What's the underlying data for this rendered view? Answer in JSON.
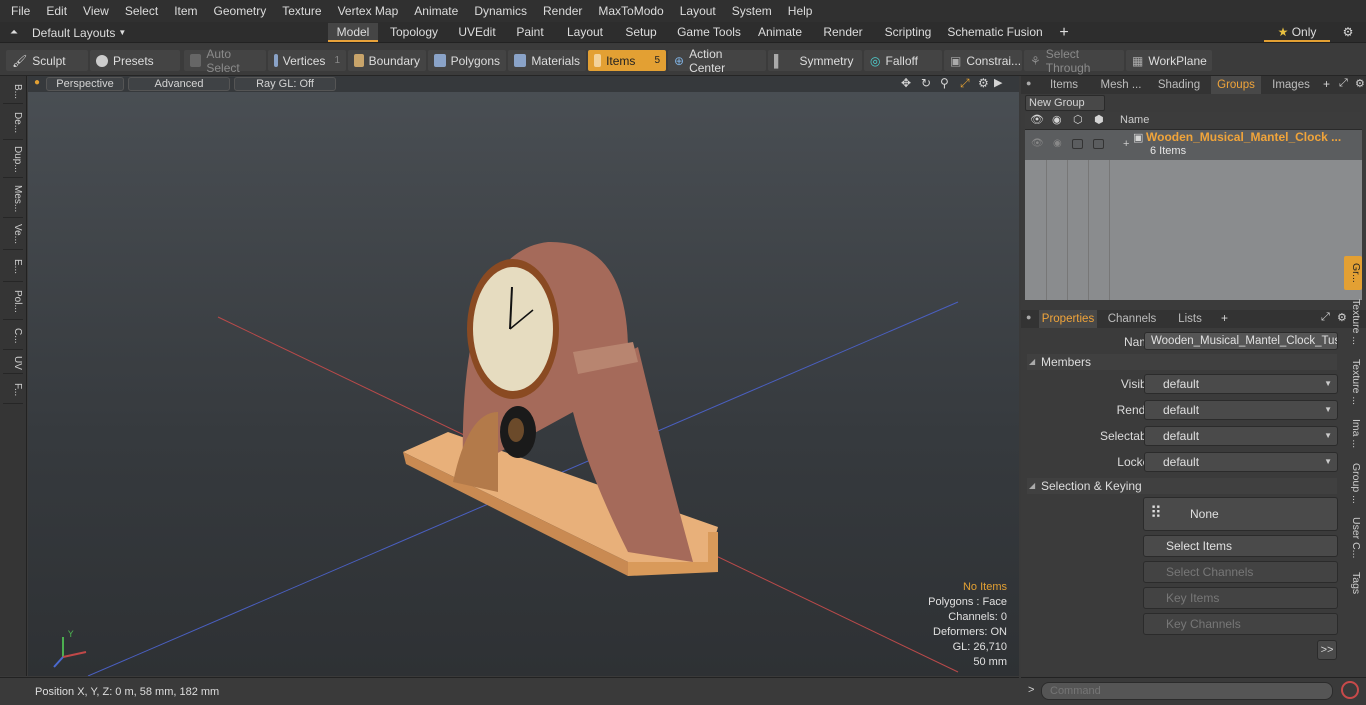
{
  "menu": [
    "File",
    "Edit",
    "View",
    "Select",
    "Item",
    "Geometry",
    "Texture",
    "Vertex Map",
    "Animate",
    "Dynamics",
    "Render",
    "MaxToModo",
    "Layout",
    "System",
    "Help"
  ],
  "layouts_label": "Default Layouts",
  "tabs": [
    "Model",
    "Topology",
    "UVEdit",
    "Paint",
    "Layout",
    "Setup",
    "Game Tools",
    "Animate",
    "Render",
    "Scripting",
    "Schematic Fusion"
  ],
  "active_tab": "Model",
  "only_label": "Only",
  "toolbar": {
    "sculpt": "Sculpt",
    "presets": "Presets",
    "auto_select": "Auto Select",
    "vertices": "Vertices",
    "vertices_count": "1",
    "boundary": "Boundary",
    "polygons": "Polygons",
    "materials": "Materials",
    "items": "Items",
    "items_count": "5",
    "action_center": "Action Center",
    "symmetry": "Symmetry",
    "falloff": "Falloff",
    "constraints": "Constrai...",
    "select_through": "Select Through",
    "workplane": "WorkPlane"
  },
  "left_tabs": [
    "B...",
    "De...",
    "Dup...",
    "Mes...",
    "Ve...",
    "E...",
    "Pol...",
    "C...",
    "UV",
    "F..."
  ],
  "viewport": {
    "perspective": "Perspective",
    "advanced": "Advanced",
    "raygl": "Ray GL: Off",
    "overlay": {
      "no_items": "No Items",
      "polygons": "Polygons : Face",
      "channels": "Channels: 0",
      "deformers": "Deformers: ON",
      "gl": "GL: 26,710",
      "scale": "50 mm"
    }
  },
  "status": {
    "position": "Position X, Y, Z:   0 m, 58 mm, 182 mm"
  },
  "colors": {
    "accent": "#e3a033",
    "orange_text": "#f0a43a"
  },
  "scene_panel": {
    "tabs": [
      "Items",
      "Mesh ...",
      "Shading",
      "Groups",
      "Images"
    ],
    "active": "Groups",
    "new_group": "New Group",
    "col_name": "Name",
    "group_name": "Wooden_Musical_Mantel_Clock ...",
    "group_sub": "6 Items"
  },
  "props_panel": {
    "tabs": [
      "Properties",
      "Channels",
      "Lists"
    ],
    "name_label": "Name",
    "name_value": "Wooden_Musical_Mantel_Clock_Tusca",
    "members": "Members",
    "visible": "Visible",
    "render": "Render",
    "selectable": "Selectable",
    "locked": "Locked",
    "default": "default",
    "selection_keying": "Selection & Keying",
    "none": "None",
    "select_items": "Select Items",
    "select_channels": "Select Channels",
    "key_items": "Key Items",
    "key_channels": "Key Channels",
    "more": ">>"
  },
  "side_tabs": [
    "Gr...",
    "Texture ...",
    "Texture ...",
    "Ima ...",
    "Group ...",
    "User C...",
    "Tags"
  ],
  "command_placeholder": "Command"
}
